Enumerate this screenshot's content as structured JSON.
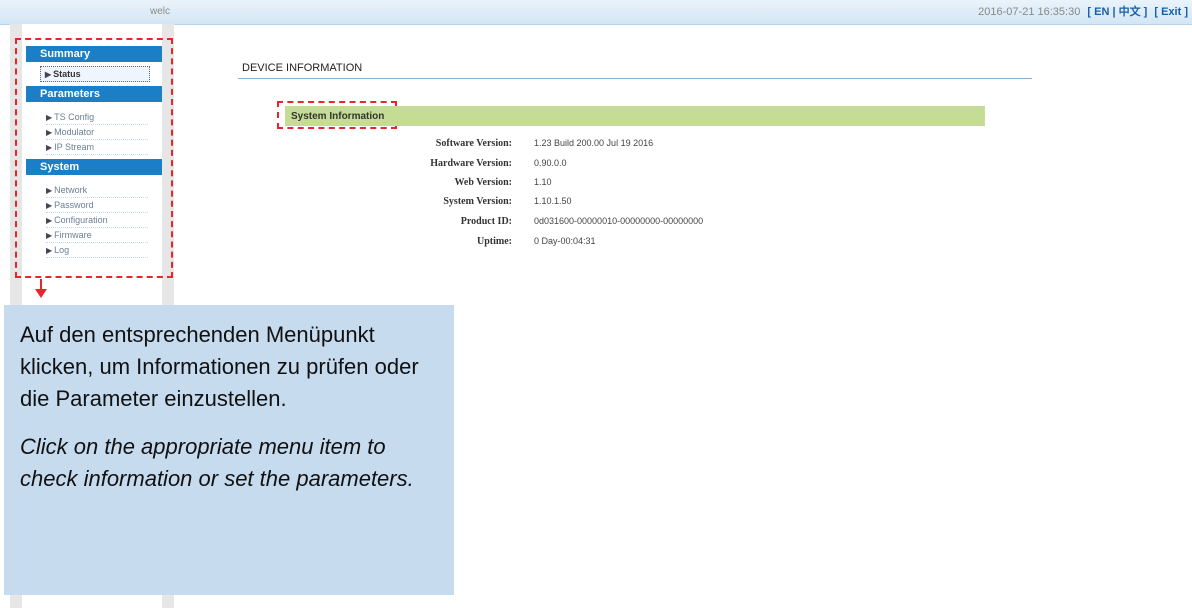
{
  "header": {
    "welcome": "welc",
    "datetime": "2016-07-21 16:35:30",
    "lang_links": "[ EN | 中文 ]",
    "exit": "[ Exit ]"
  },
  "sidebar": {
    "sections": [
      {
        "title": "Summary",
        "items": [
          "Status"
        ]
      },
      {
        "title": "Parameters",
        "items": [
          "TS Config",
          "Modulator",
          "IP Stream"
        ]
      },
      {
        "title": "System",
        "items": [
          "Network",
          "Password",
          "Configuration",
          "Firmware",
          "Log"
        ]
      }
    ],
    "active_item": "Status"
  },
  "main": {
    "page_title": "DEVICE INFORMATION",
    "section_title": "System Information",
    "rows": [
      {
        "label": "Software Version:",
        "value": "1.23 Build 200.00 Jul 19 2016"
      },
      {
        "label": "Hardware Version:",
        "value": "0.90.0.0"
      },
      {
        "label": "Web Version:",
        "value": "1.10"
      },
      {
        "label": "System Version:",
        "value": "1.10.1.50"
      },
      {
        "label": "Product ID:",
        "value": "0d031600-00000010-00000000-00000000"
      },
      {
        "label": "Uptime:",
        "value": "0 Day-00:04:31"
      }
    ]
  },
  "callout": {
    "german": "Auf den entsprechenden Menüpunkt klicken, um Informationen zu prüfen oder die Parameter einzustellen.",
    "english": "Click on the appropriate menu item to check information or set the parameters."
  },
  "colors": {
    "menu_header": "#1a7fc7",
    "section_bar": "#c5dc94",
    "callout_bg": "#c7dbef",
    "highlight": "#e8262a"
  }
}
